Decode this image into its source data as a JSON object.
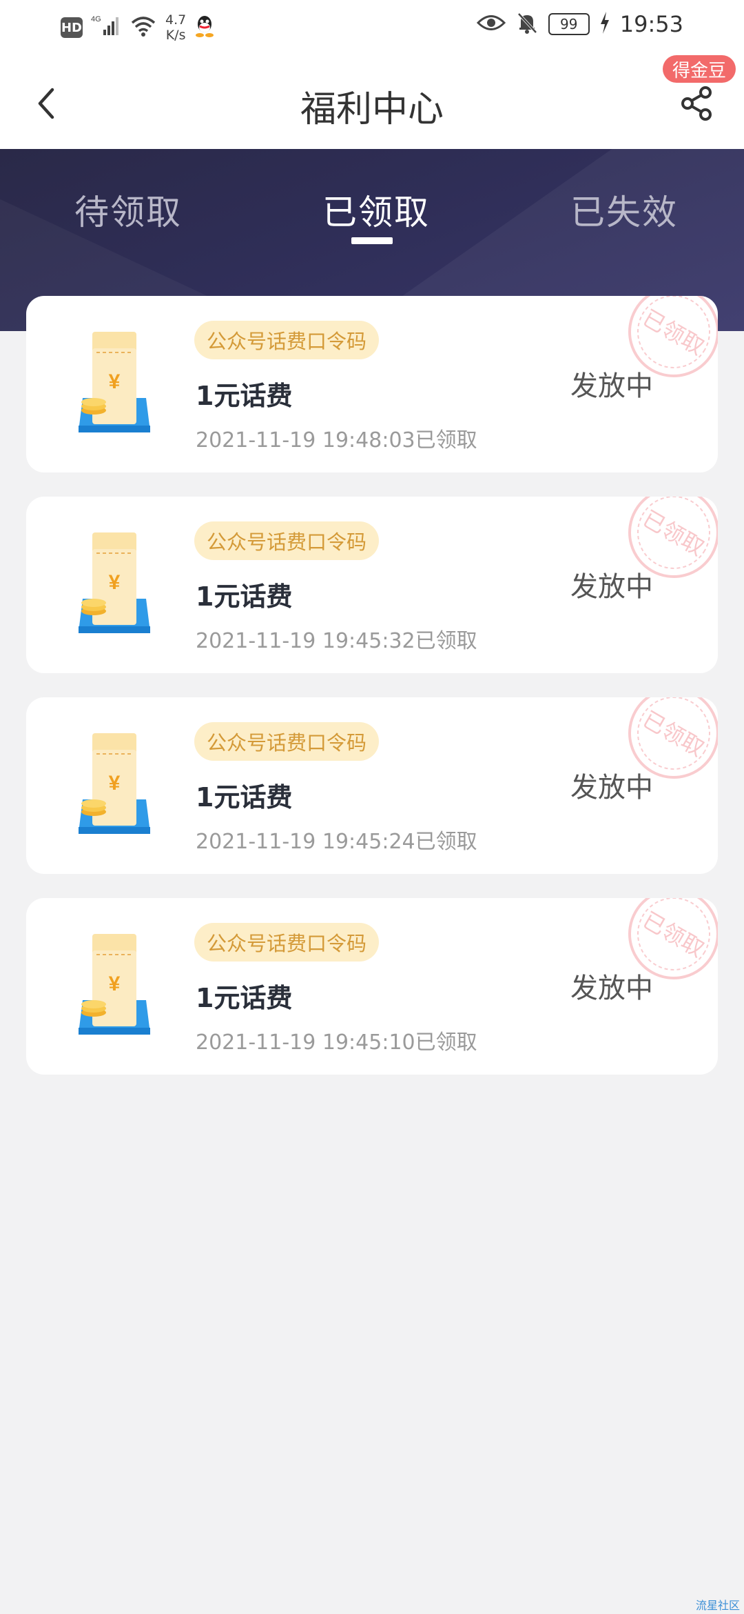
{
  "status_bar": {
    "hd": "HD",
    "network": "4G",
    "speed_value": "4.7",
    "speed_unit": "K/s",
    "battery": "99",
    "time": "19:53"
  },
  "header": {
    "title": "福利中心",
    "badge": "得金豆"
  },
  "tabs": [
    {
      "label": "待领取",
      "active": false
    },
    {
      "label": "已领取",
      "active": true
    },
    {
      "label": "已失效",
      "active": false
    }
  ],
  "cards": [
    {
      "tag": "公众号话费口令码",
      "title": "1元话费",
      "time": "2021-11-19 19:48:03已领取",
      "status": "发放中",
      "stamp": "已领取"
    },
    {
      "tag": "公众号话费口令码",
      "title": "1元话费",
      "time": "2021-11-19 19:45:32已领取",
      "status": "发放中",
      "stamp": "已领取"
    },
    {
      "tag": "公众号话费口令码",
      "title": "1元话费",
      "time": "2021-11-19 19:45:24已领取",
      "status": "发放中",
      "stamp": "已领取"
    },
    {
      "tag": "公众号话费口令码",
      "title": "1元话费",
      "time": "2021-11-19 19:45:10已领取",
      "status": "发放中",
      "stamp": "已领取"
    }
  ],
  "icon_symbol": "¥",
  "watermark": "流星社区",
  "colors": {
    "band": "#2f2e57",
    "tag_bg": "#fdeec8",
    "tag_text": "#d49a38",
    "badge": "#f26a6a",
    "stamp": "#f4a3a8"
  }
}
